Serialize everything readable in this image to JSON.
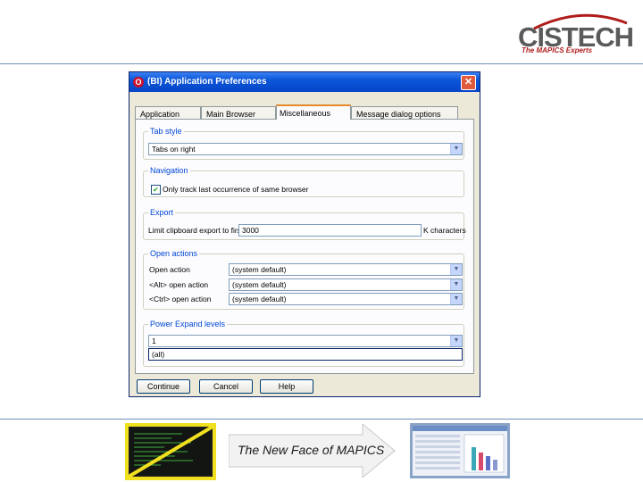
{
  "brand": {
    "name": "CISTECH",
    "tagline": "The MAPICS Experts"
  },
  "dialog": {
    "title": "(BI) Application Preferences",
    "close_glyph": "✕",
    "icon_glyph": "O",
    "tabs": [
      "Application",
      "Main Browser",
      "Miscellaneous",
      "Message dialog options"
    ],
    "active_tab": "Miscellaneous",
    "tab_style": {
      "label": "Tab style",
      "value": "Tabs on right"
    },
    "navigation": {
      "label": "Navigation",
      "checkbox_label": "Only track last occurrence of same browser",
      "checked": true
    },
    "export": {
      "label": "Export",
      "prefix": "Limit clipboard export to first",
      "value": "3000",
      "suffix": "K characters"
    },
    "open_actions": {
      "label": "Open actions",
      "rows": [
        {
          "label": "Open action",
          "value": "(system default)"
        },
        {
          "label": "<Alt> open action",
          "value": "(system default)"
        },
        {
          "label": "<Ctrl> open action",
          "value": "(system default)"
        }
      ]
    },
    "power_expand": {
      "label": "Power Expand levels",
      "value": "1",
      "list_item": "(all)"
    },
    "buttons": {
      "continue": "Continue",
      "cancel": "Cancel",
      "help": "Help"
    }
  },
  "footer": {
    "tagline": "The New Face of MAPICS"
  },
  "colors": {
    "titlebar": "#0a55d8",
    "group_label": "#0046d5",
    "logo_red": "#b01c1c",
    "thumb_border": "#f0e020"
  }
}
